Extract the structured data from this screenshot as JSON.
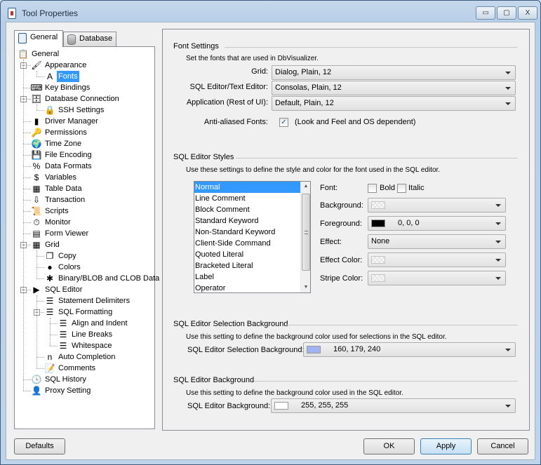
{
  "window": {
    "title": "Tool Properties",
    "controls": {
      "minimize": "▭",
      "maximize": "▢",
      "close": "X"
    }
  },
  "tabs": [
    {
      "label": "General",
      "icon": "clipboard-icon",
      "active": true
    },
    {
      "label": "Database",
      "icon": "database-icon",
      "active": false
    }
  ],
  "tree": [
    {
      "label": "General",
      "icon": "clipboard-icon",
      "glyph": "📋",
      "level": 0
    },
    {
      "label": "Appearance",
      "icon": "paintbrush-icon",
      "glyph": "🖌",
      "level": 1,
      "expanded": true
    },
    {
      "label": "Fonts",
      "icon": "font-icon",
      "glyph": "A",
      "level": 2,
      "selected": true
    },
    {
      "label": "Key Bindings",
      "icon": "keyboard-icon",
      "glyph": "⌨",
      "level": 1
    },
    {
      "label": "Database Connection",
      "icon": "database-icon",
      "glyph": "🗄",
      "level": 1,
      "expanded": true
    },
    {
      "label": "SSH Settings",
      "icon": "ssh-icon",
      "glyph": "🔒",
      "level": 2
    },
    {
      "label": "Driver Manager",
      "icon": "driver-icon",
      "glyph": "▮",
      "level": 1
    },
    {
      "label": "Permissions",
      "icon": "key-icon",
      "glyph": "🔑",
      "level": 1
    },
    {
      "label": "Time Zone",
      "icon": "globe-icon",
      "glyph": "🌍",
      "level": 1
    },
    {
      "label": "File Encoding",
      "icon": "floppy-icon",
      "glyph": "💾",
      "level": 1
    },
    {
      "label": "Data Formats",
      "icon": "percent-icon",
      "glyph": "%",
      "level": 1
    },
    {
      "label": "Variables",
      "icon": "variable-icon",
      "glyph": "$",
      "level": 1
    },
    {
      "label": "Table Data",
      "icon": "table-icon",
      "glyph": "▦",
      "level": 1
    },
    {
      "label": "Transaction",
      "icon": "transaction-icon",
      "glyph": "⇩",
      "level": 1
    },
    {
      "label": "Scripts",
      "icon": "scroll-icon",
      "glyph": "📜",
      "level": 1
    },
    {
      "label": "Monitor",
      "icon": "stopwatch-icon",
      "glyph": "⏱",
      "level": 1
    },
    {
      "label": "Form Viewer",
      "icon": "form-icon",
      "glyph": "▤",
      "level": 1
    },
    {
      "label": "Grid",
      "icon": "grid-icon",
      "glyph": "▦",
      "level": 1,
      "expanded": true
    },
    {
      "label": "Copy",
      "icon": "copy-icon",
      "glyph": "❐",
      "level": 2
    },
    {
      "label": "Colors",
      "icon": "color-wheel-icon",
      "glyph": "●",
      "level": 2
    },
    {
      "label": "Binary/BLOB and CLOB Data",
      "icon": "blob-icon",
      "glyph": "✱",
      "level": 2
    },
    {
      "label": "SQL Editor",
      "icon": "play-icon",
      "glyph": "▶",
      "level": 1,
      "expanded": true
    },
    {
      "label": "Statement Delimiters",
      "icon": "delimiter-icon",
      "glyph": "☰",
      "level": 2
    },
    {
      "label": "SQL Formatting",
      "icon": "format-icon",
      "glyph": "☰",
      "level": 2,
      "expanded": true
    },
    {
      "label": "Align and Indent",
      "icon": "format-icon",
      "glyph": "☰",
      "level": 3
    },
    {
      "label": "Line Breaks",
      "icon": "format-icon",
      "glyph": "☰",
      "level": 3
    },
    {
      "label": "Whitespace",
      "icon": "format-icon",
      "glyph": "☰",
      "level": 3
    },
    {
      "label": "Auto Completion",
      "icon": "completion-icon",
      "glyph": "n",
      "level": 2
    },
    {
      "label": "Comments",
      "icon": "note-icon",
      "glyph": "📝",
      "level": 2
    },
    {
      "label": "SQL History",
      "icon": "history-icon",
      "glyph": "🕓",
      "level": 1
    },
    {
      "label": "Proxy Setting",
      "icon": "agent-icon",
      "glyph": "👤",
      "level": 1
    }
  ],
  "font_settings": {
    "title": "Font Settings",
    "description": "Set the fonts that are used in DbVisualizer.",
    "fields": [
      {
        "label": "Grid:",
        "value": "Dialog, Plain, 12"
      },
      {
        "label": "SQL Editor/Text Editor:",
        "value": "Consolas, Plain, 12"
      },
      {
        "label": "Application (Rest of UI):",
        "value": "Default, Plain, 12"
      }
    ],
    "antialias": {
      "label": "Anti-aliased Fonts:",
      "checked": true,
      "note": "(Look and Feel and OS dependent)"
    }
  },
  "styles": {
    "title": "SQL Editor Styles",
    "description": "Use these settings to define the style and color for the font used in the SQL editor.",
    "list": [
      "Normal",
      "Line Comment",
      "Block Comment",
      "Standard Keyword",
      "Non-Standard Keyword",
      "Client-Side Command",
      "Quoted Literal",
      "Bracketed Literal",
      "Label",
      "Operator"
    ],
    "selected_index": 0,
    "font_label": "Font:",
    "bold_label": "Bold",
    "bold_checked": false,
    "italic_label": "Italic",
    "italic_checked": false,
    "background_label": "Background:",
    "background_value": "",
    "foreground_label": "Foreground:",
    "foreground_value": "0, 0, 0",
    "foreground_color": "#000000",
    "effect_label": "Effect:",
    "effect_value": "None",
    "effect_color_label": "Effect Color:",
    "stripe_color_label": "Stripe Color:"
  },
  "selection_bg": {
    "title": "SQL Editor Selection Background",
    "description": "Use this setting to define the background color used for selections in the SQL editor.",
    "label": "SQL Editor Selection Background:",
    "value": "160, 179, 240",
    "color": "#a0b3f0"
  },
  "editor_bg": {
    "title": "SQL Editor Background",
    "description": "Use this setting to define the background color used in the SQL editor.",
    "label": "SQL Editor Background:",
    "value": "255, 255, 255",
    "color": "#ffffff"
  },
  "buttons": {
    "defaults": "Defaults",
    "ok": "OK",
    "apply": "Apply",
    "cancel": "Cancel"
  },
  "colors": {
    "selection": "#3399ff",
    "accent_border": "#3c7fb1"
  }
}
